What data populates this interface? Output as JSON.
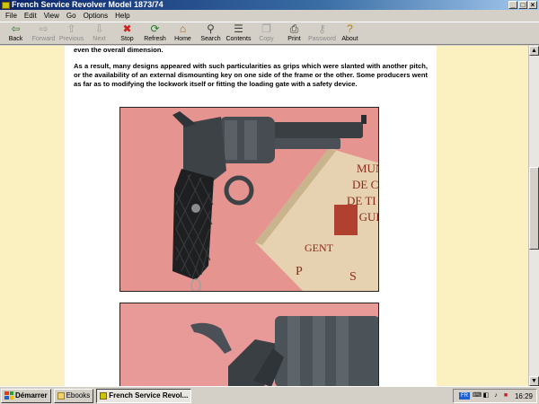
{
  "window": {
    "title": "French Service Revolver Model 1873/74",
    "controls": [
      "_",
      "□",
      "×"
    ]
  },
  "menu": [
    "File",
    "Edit",
    "View",
    "Go",
    "Options",
    "Help"
  ],
  "toolbar": [
    {
      "label": "Back",
      "icon": "back-arrow-icon",
      "glyph": "⇦",
      "color": "#2a7a2a",
      "enabled": true
    },
    {
      "label": "Forward",
      "icon": "forward-arrow-icon",
      "glyph": "⇨",
      "color": "#a0a0a0",
      "enabled": false
    },
    {
      "label": "Previous",
      "icon": "previous-arrow-icon",
      "glyph": "⇧",
      "color": "#a0a0a0",
      "enabled": false
    },
    {
      "label": "Next",
      "icon": "next-arrow-icon",
      "glyph": "⇩",
      "color": "#a0a0a0",
      "enabled": false
    },
    {
      "label": "Stop",
      "icon": "stop-icon",
      "glyph": "✖",
      "color": "#d02020",
      "enabled": true
    },
    {
      "label": "Refresh",
      "icon": "refresh-icon",
      "glyph": "⟳",
      "color": "#2a7a2a",
      "enabled": true
    },
    {
      "label": "Home",
      "icon": "home-icon",
      "glyph": "⌂",
      "color": "#a06020",
      "enabled": true
    },
    {
      "label": "Search",
      "icon": "search-icon",
      "glyph": "⚲",
      "color": "#404040",
      "enabled": true
    },
    {
      "label": "Contents",
      "icon": "contents-icon",
      "glyph": "☰",
      "color": "#404040",
      "enabled": true
    },
    {
      "label": "Copy",
      "icon": "copy-icon",
      "glyph": "❐",
      "color": "#a0a0a0",
      "enabled": false
    },
    {
      "label": "Print",
      "icon": "print-icon",
      "glyph": "⎙",
      "color": "#303030",
      "enabled": true
    },
    {
      "label": "Password",
      "icon": "password-key-icon",
      "glyph": "⚷",
      "color": "#a0a0a0",
      "enabled": false
    },
    {
      "label": "About",
      "icon": "about-icon",
      "glyph": "?",
      "color": "#c08000",
      "enabled": true
    }
  ],
  "content": {
    "line_top": "even the overall dimension.",
    "paragraph": "As a result, many designs appeared with such particularities as grips which were slanted with another pitch, or the availability of an external dismounting key on one side of the frame or the other. Some producers went as far as to modifying the lockwork itself or fitting the loading gate with a safety device.",
    "booklet_text": [
      "MUN",
      "DE C",
      "DE TI",
      "DE GUE",
      "GENT",
      "P",
      "S"
    ]
  },
  "taskbar": {
    "start_label": "Démarrer",
    "tasks": [
      {
        "label": "Ebooks",
        "active": false
      },
      {
        "label": "French Service Revol...",
        "active": true
      }
    ],
    "tray_lang": "FR",
    "clock": "16:29"
  },
  "colors": {
    "page_background": "#fbf1c0",
    "titlebar": "#0a246a"
  }
}
